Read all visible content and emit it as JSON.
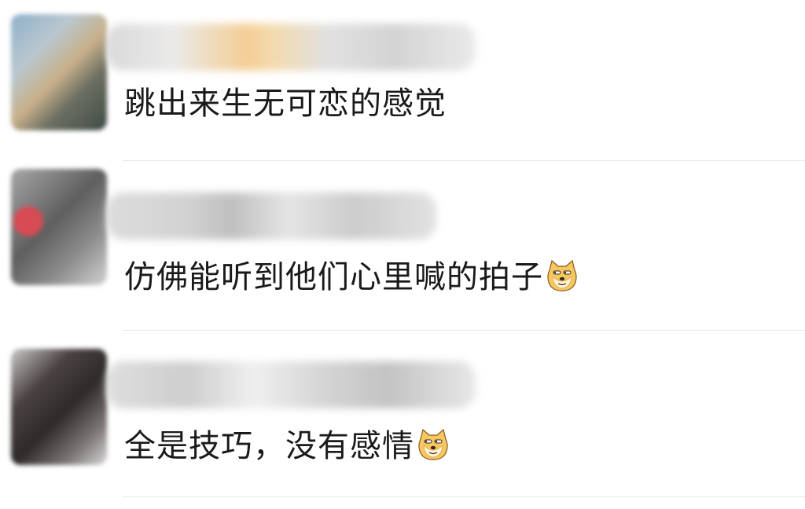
{
  "comments": [
    {
      "text": "跳出来生无可恋的感觉",
      "emoji": null
    },
    {
      "text": "仿佛能听到他们心里喊的拍子",
      "emoji": "doge-face-icon"
    },
    {
      "text": "全是技巧，没有感情",
      "emoji": "doge-face-icon"
    }
  ],
  "colors": {
    "text": "#1a1a1a",
    "divider": "#e7e7e7",
    "emoji_fill": "#f7c760",
    "emoji_outline": "#8a5a1e"
  }
}
